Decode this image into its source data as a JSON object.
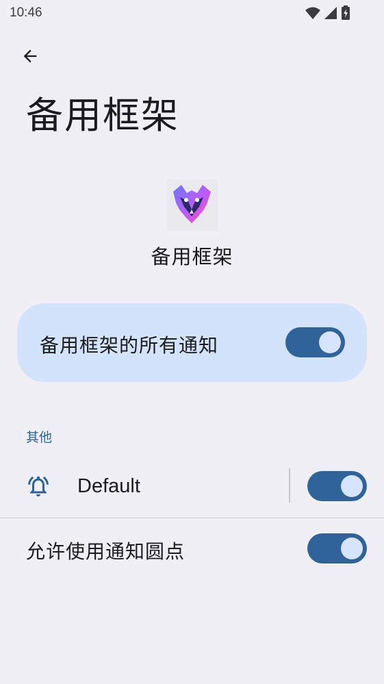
{
  "status_bar": {
    "time": "10:46",
    "icons": [
      "wifi-icon",
      "signal-icon",
      "battery-charging-icon"
    ]
  },
  "header": {
    "back_icon": "arrow-back-icon",
    "title": "备用框架"
  },
  "app": {
    "icon": "app-logo-icon",
    "name": "备用框架"
  },
  "all_notifications": {
    "label": "备用框架的所有通知",
    "enabled": true
  },
  "other_section": {
    "header": "其他",
    "channels": [
      {
        "icon": "bell-ring-icon",
        "label": "Default",
        "enabled": true
      }
    ]
  },
  "notification_dots": {
    "label": "允许使用通知圆点",
    "enabled": true
  },
  "colors": {
    "background": "#f0eff5",
    "card": "#d3e3fc",
    "accent": "#2f6399",
    "knob": "#d6e4ff"
  }
}
